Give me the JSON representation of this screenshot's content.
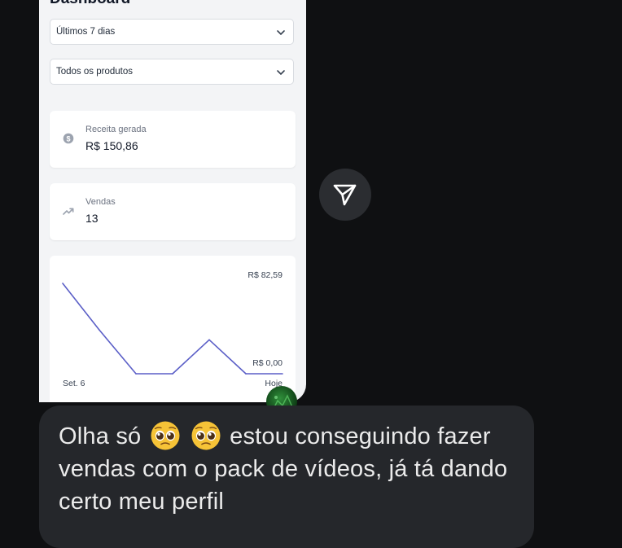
{
  "dashboard": {
    "title": "Dashboard",
    "period_select": "Últimos 7 dias",
    "product_select": "Todos os produtos",
    "revenue": {
      "label": "Receita gerada",
      "value": "R$ 150,86",
      "icon": "dollar-circle-icon"
    },
    "sales": {
      "label": "Vendas",
      "value": "13",
      "icon": "trending-up-icon"
    }
  },
  "chart_data": {
    "type": "line",
    "x_start_label": "Set. 6",
    "x_end_label": "Hoje",
    "max_label": "R$ 82,59",
    "min_label": "R$ 0,00",
    "ylim": [
      0,
      82.59
    ],
    "values": [
      82.59,
      40,
      0,
      0,
      31,
      0,
      0
    ],
    "color": "#5b5fc7"
  },
  "message": {
    "text_before": "Olha só",
    "emojis": [
      "pleading-face",
      "pleading-face"
    ],
    "text_after": "estou conseguindo fazer vendas com o pack de vídeos, já tá dando certo meu perfil"
  },
  "send_button": {
    "icon": "send-icon"
  }
}
